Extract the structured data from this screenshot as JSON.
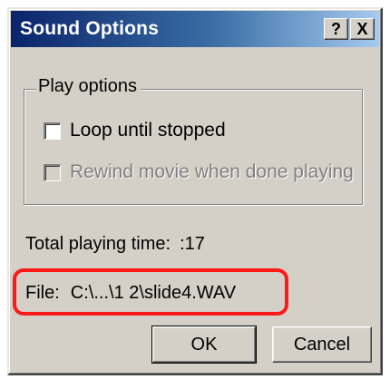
{
  "window": {
    "title": "Sound Options",
    "help_label": "?",
    "close_label": "X"
  },
  "play_options": {
    "legend": "Play options",
    "loop_label": "Loop until stopped",
    "loop_checked": false,
    "rewind_label": "Rewind movie when done playing",
    "rewind_checked": false,
    "rewind_disabled": true
  },
  "info": {
    "total_label": "Total playing time:",
    "total_value": ":17",
    "file_label": "File:",
    "file_value": "C:\\...\\1 2\\slide4.WAV"
  },
  "buttons": {
    "ok_label": "OK",
    "cancel_label": "Cancel"
  },
  "colors": {
    "titlebar_start": "#0a246a",
    "titlebar_end": "#a6caf0",
    "dialog_face": "#d4d0c8",
    "highlight": "#ff1a1a"
  }
}
